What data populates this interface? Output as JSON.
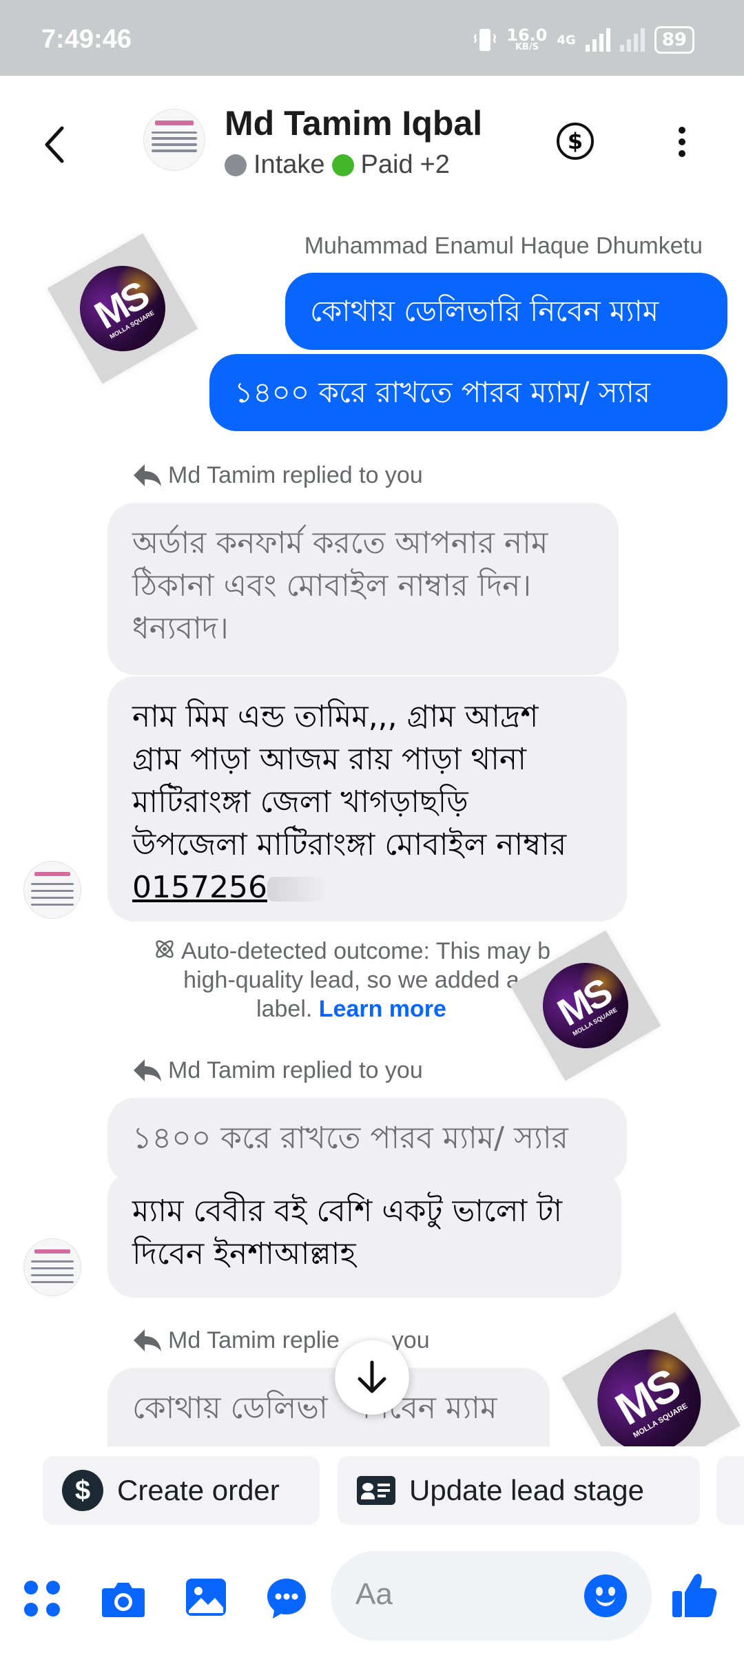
{
  "status_bar": {
    "time": "7:49:46",
    "speed_value": "16.0",
    "speed_unit": "KB/S",
    "network": "4G",
    "battery": "89"
  },
  "header": {
    "contact_name": "Md Tamim Iqbal",
    "label_1": "Intake",
    "label_2": "Paid",
    "extra_labels": "+2",
    "label_1_color": "#8a8d91",
    "label_2_color": "#42b72a"
  },
  "messages": {
    "sender_name": "Muhammad Enamul Haque Dhumketu",
    "outgoing": [
      "কোথায় ডেলিভারি নিবেন ম্যাম",
      "১৪০০ করে রাখতে পারব ম্যাম/ স্যার"
    ],
    "reply_label": "Md Tamim replied to you",
    "reply_label_partial_a": "Md Tamim replie",
    "reply_label_partial_b": "you",
    "reply1": {
      "quoted_line1": "অর্ডার কনফার্ম করতে আপনার নাম",
      "quoted_line2": "ঠিকানা এবং মোবাইল নাম্বার দিন।",
      "quoted_line3": "ধন্যবাদ।",
      "text_line1": "নাম মিম এন্ড তামিম,,, গ্রাম আদ্রশ",
      "text_line2": "গ্রাম পাড়া আজম রায় পাড়া থানা",
      "text_line3": "মাটিরাংঙ্গা জেলা খাগড়াছড়ি",
      "text_line4": "উপজেলা মাটিরাংঙ্গা মোবাইল নাম্বার",
      "phone_visible": "0157256"
    },
    "notice": {
      "line1": "Auto-detected outcome: This may b",
      "line2": "high-quality lead, so we added a",
      "line3": "label.",
      "link": "Learn more"
    },
    "reply2": {
      "quoted": "১৪০০ করে রাখতে পারব ম্যাম/ স্যার",
      "text_line1": "ম্যাম বেবীর বই বেশি একটু ভালো টা",
      "text_line2": "দিবেন ইনশাআল্লাহ"
    },
    "reply3": {
      "quoted_a": "কোথায় ডেলিভা",
      "quoted_b": "নিবেন ম্যাম"
    }
  },
  "watermark": {
    "letters": "MS",
    "text": "MOLLA SQUARE"
  },
  "quick_actions": {
    "create_order": "Create order",
    "update_lead": "Update lead stage"
  },
  "composer": {
    "placeholder": "Aa",
    "accent_color": "#0866ff"
  }
}
